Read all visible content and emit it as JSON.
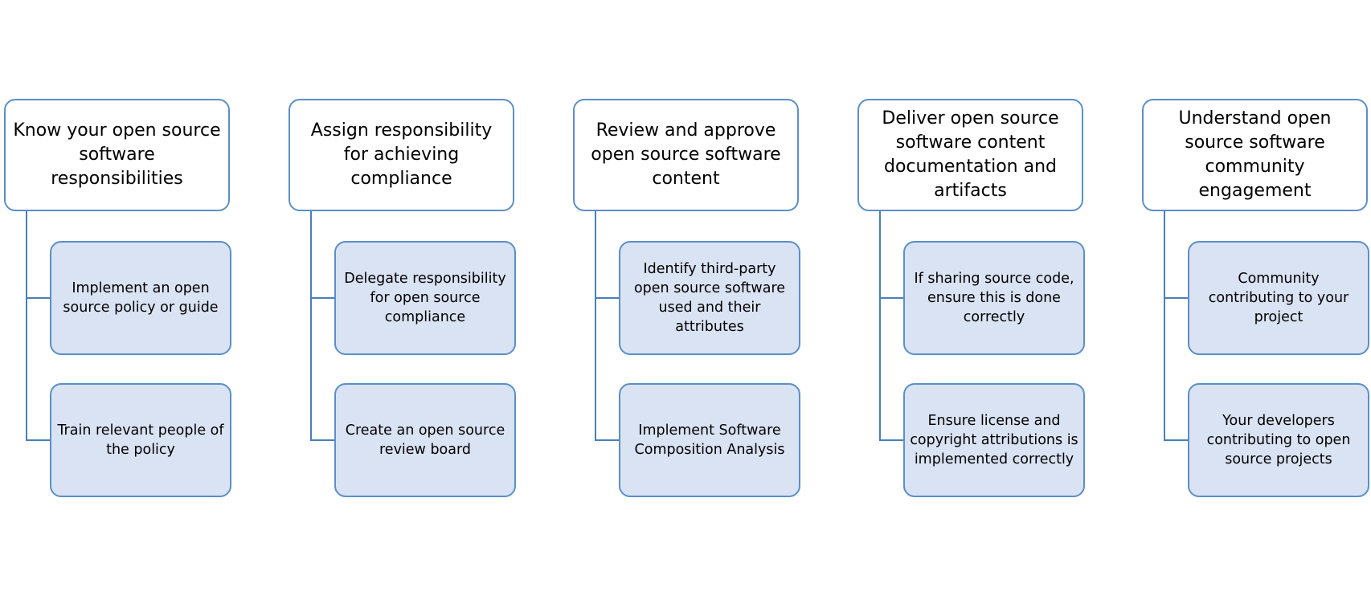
{
  "colors": {
    "border": "#5b8fc9",
    "child_fill": "#dae3f3",
    "connector": "#4a7ebb"
  },
  "columns": [
    {
      "title": "Know your open source software responsibilities",
      "children": [
        "Implement an open source policy or guide",
        "Train relevant people of the policy"
      ]
    },
    {
      "title": "Assign responsibility for achieving compliance",
      "children": [
        "Delegate responsibility for open source compliance",
        "Create an open source review board"
      ]
    },
    {
      "title": "Review and approve open source software content",
      "children": [
        "Identify third-party open source software used and their attributes",
        "Implement Software Composition Analysis"
      ]
    },
    {
      "title": "Deliver open source software content documentation and artifacts",
      "children": [
        "If sharing source code, ensure this is done correctly",
        "Ensure license and copyright attributions is implemented correctly"
      ]
    },
    {
      "title": "Understand open source software community engagement",
      "children": [
        "Community contributing to your project",
        "Your developers contributing to open source projects"
      ]
    }
  ]
}
